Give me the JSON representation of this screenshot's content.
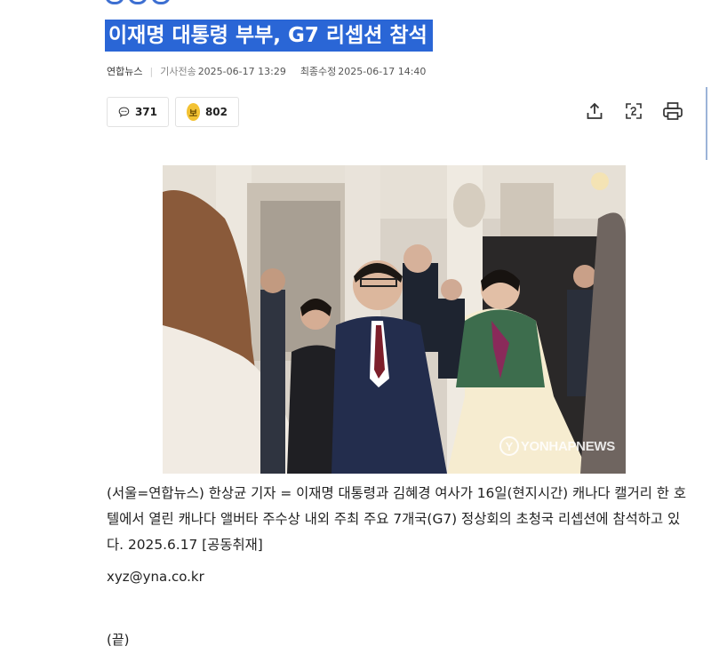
{
  "article": {
    "headline": "이재명 대통령 부부, G7 리셉션 참석",
    "source": "연합뉴스",
    "sent_label": "기사전송",
    "sent_time": "2025-06-17 13:29",
    "modified_label": "최종수정",
    "modified_time": "2025-06-17 14:40"
  },
  "actions": {
    "comment_count": "371",
    "like_badge": "보",
    "like_count": "802"
  },
  "photo": {
    "watermark": "YONHAPNEWS",
    "watermark_badge": "Y"
  },
  "body": {
    "caption": "(서울=연합뉴스) 한상균 기자 = 이재명 대통령과 김혜경 여사가 16일(현지시간) 캐나다 캘거리 한 호텔에서 열린 캐나다 앨버타 주수상 내외 주최 주요 7개국(G7) 정상회의 초청국 리셉션에 참석하고 있다. 2025.6.17 [공동취재]",
    "email": "xyz@yna.co.kr",
    "end": "(끝)"
  },
  "colors": {
    "headline_highlight": "#2a66d6",
    "like_badge": "#f3c233"
  }
}
